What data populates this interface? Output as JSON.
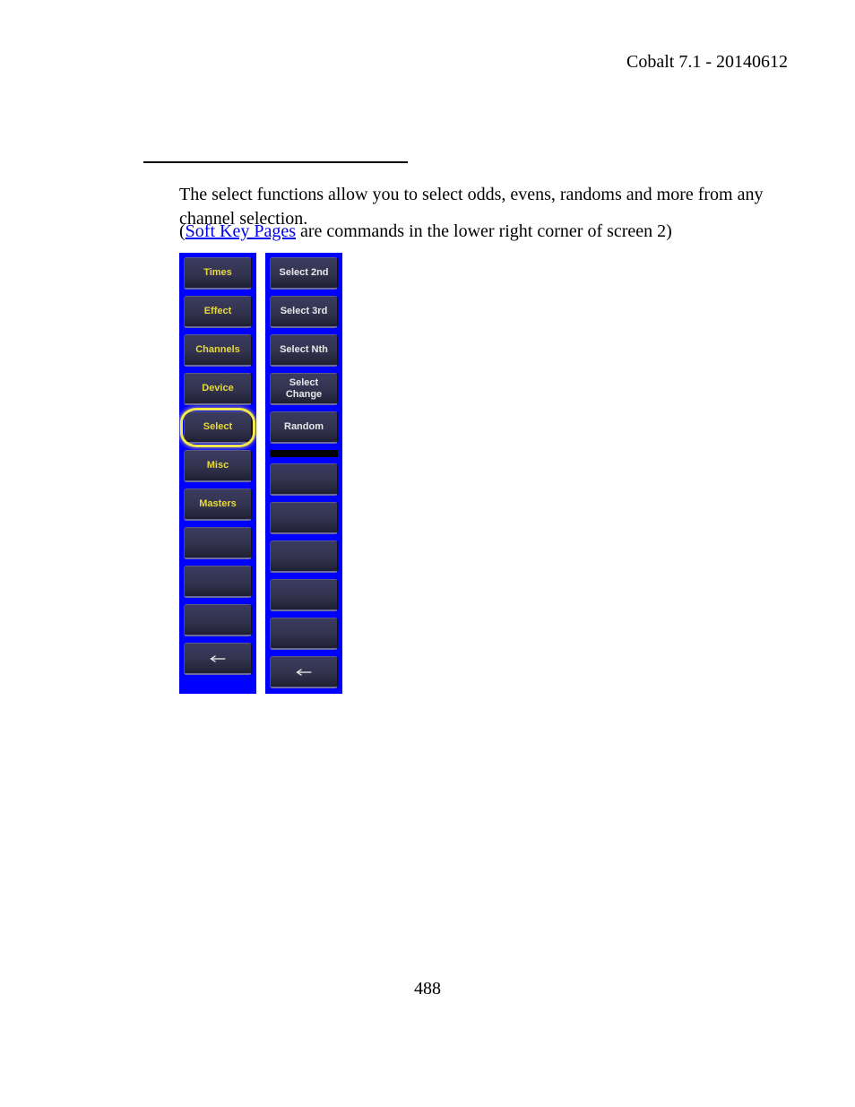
{
  "header": "Cobalt 7.1 - 20140612",
  "para1": "The select functions allow you to select odds, evens, randoms and more from any channel selection.",
  "para2_open": "(",
  "para2_link": "Soft Key Pages",
  "para2_rest": " are commands in the lower right corner of screen 2)",
  "left_panel": {
    "items": [
      {
        "label": "Times",
        "style": "yellow"
      },
      {
        "label": "Effect",
        "style": "yellow"
      },
      {
        "label": "Channels",
        "style": "yellow"
      },
      {
        "label": "Device",
        "style": "yellow"
      },
      {
        "label": "Select",
        "style": "yellow",
        "highlighted": true
      },
      {
        "label": "Misc",
        "style": "yellow"
      },
      {
        "label": "Masters",
        "style": "yellow"
      },
      {
        "label": "",
        "style": "empty"
      },
      {
        "label": "",
        "style": "empty"
      },
      {
        "label": "",
        "style": "empty"
      },
      {
        "label": "←",
        "style": "white",
        "arrow": true
      }
    ]
  },
  "right_panel": {
    "items": [
      {
        "label": "Select 2nd",
        "style": "white"
      },
      {
        "label": "Select 3rd",
        "style": "white"
      },
      {
        "label": "Select Nth",
        "style": "white"
      },
      {
        "label": "Select\nChange",
        "style": "white"
      },
      {
        "label": "Random",
        "style": "white"
      },
      {
        "spacer": true
      },
      {
        "label": "",
        "style": "empty"
      },
      {
        "label": "",
        "style": "empty"
      },
      {
        "label": "",
        "style": "empty"
      },
      {
        "label": "",
        "style": "empty"
      },
      {
        "label": "",
        "style": "empty"
      },
      {
        "label": "←",
        "style": "white",
        "arrow": true
      }
    ]
  },
  "page_number": "488"
}
